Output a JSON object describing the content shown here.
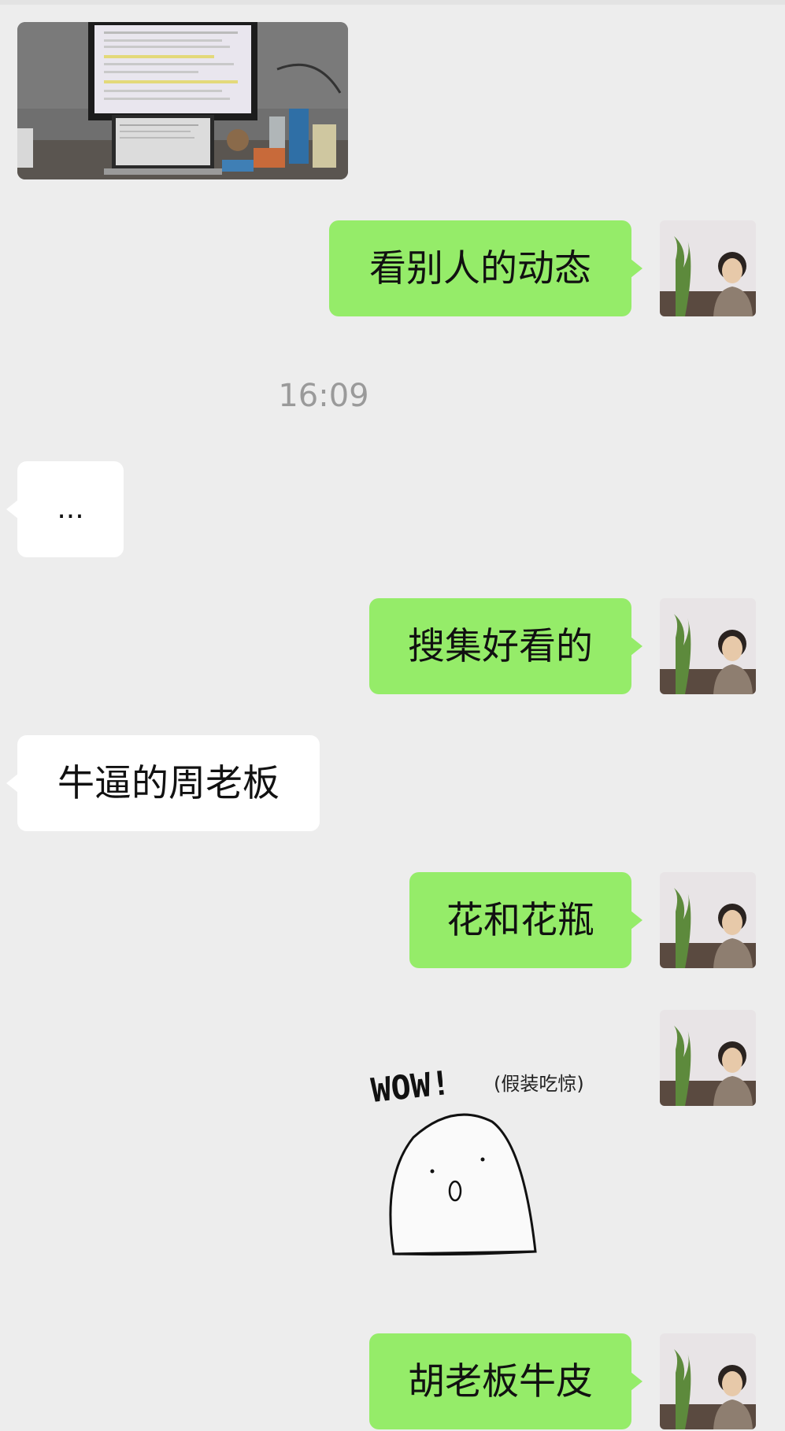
{
  "chat": {
    "timestamp": "16:09",
    "messages": [
      {
        "side": "me",
        "text": "看别人的动态"
      },
      {
        "side": "other",
        "text": "..."
      },
      {
        "side": "me",
        "text": "搜集好看的"
      },
      {
        "side": "other",
        "text": "牛逼的周老板"
      },
      {
        "side": "me",
        "text": "花和花瓶"
      },
      {
        "side": "me",
        "text": "胡老板牛皮"
      }
    ],
    "sticker": {
      "main": "WOW!",
      "sub": "(假装吃惊)"
    }
  },
  "colors": {
    "background": "#ededed",
    "my_bubble": "#95ec69",
    "other_bubble": "#ffffff",
    "timestamp_text": "#9a9a9a"
  }
}
